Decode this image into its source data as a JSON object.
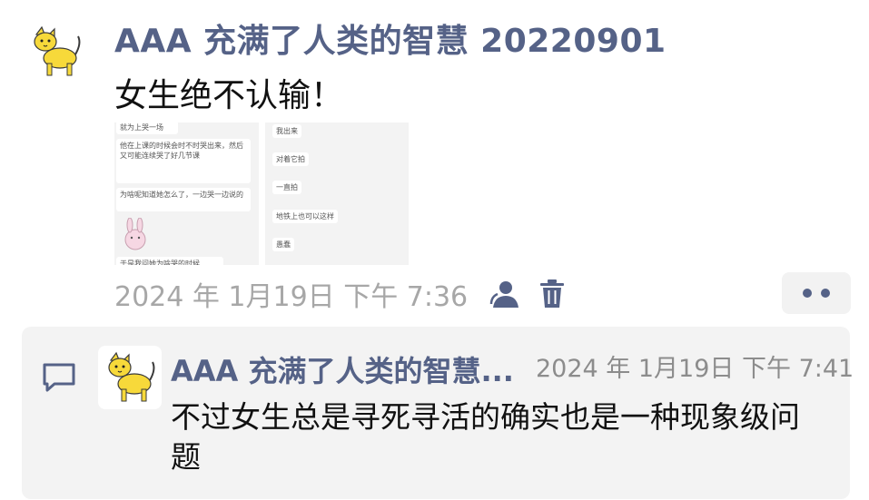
{
  "post": {
    "author": "AAA 充满了人类的智慧 20220901",
    "text": "女生绝不认输！",
    "timestamp": "2024 年 1月19日 下午 7:36",
    "images": [
      {
        "bubbles": [
          "就为上哭一场",
          "他在上课的时候会时不时哭出来，然后又可能连续哭了好几节课",
          "为啥呢知道她怎么了，一边哭一边说的",
          "于是我问她为啥哭的时候"
        ]
      },
      {
        "bubbles": [
          "我出来",
          "对着它拍",
          "一直拍",
          "地铁上也可以这样",
          "愚蠢"
        ]
      }
    ]
  },
  "comment": {
    "author": "AAA 充满了人类的智慧...",
    "timestamp": "2024 年 1月19日 下午 7:41",
    "text": "不过女生总是寻死寻活的确实也是一种现象级问题"
  },
  "icons": {
    "avatar": "cat-icon",
    "privacy": "users-icon",
    "delete": "trash-icon",
    "more": "more-dots-icon",
    "comment": "comment-icon"
  },
  "colors": {
    "accent": "#556287",
    "timestamp": "#a7a7a7",
    "panel": "#f3f3f3"
  }
}
